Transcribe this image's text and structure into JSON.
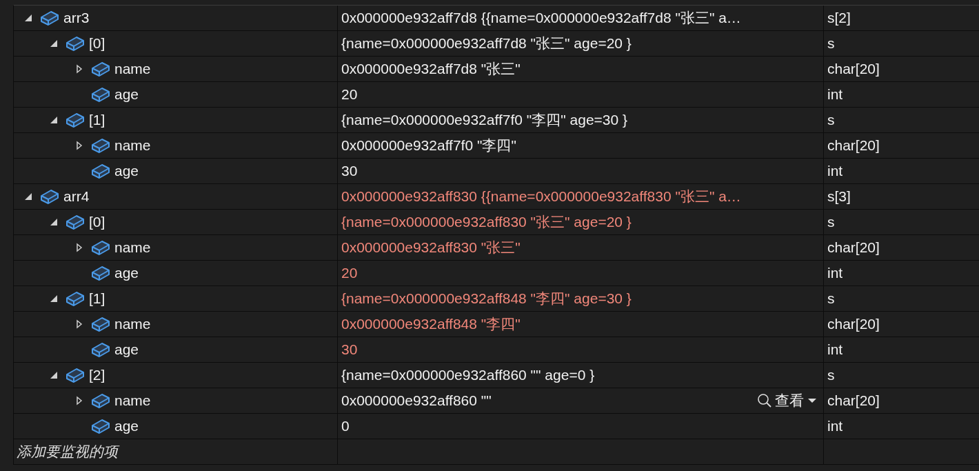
{
  "watch": {
    "items": [
      {
        "name": "arr3",
        "value": "0x000000e932aff7d8 {{name=0x000000e932aff7d8 \"张三\" a…",
        "type": "s[2]",
        "changed": false,
        "expanded": true,
        "children": [
          {
            "name": "[0]",
            "value": "{name=0x000000e932aff7d8 \"张三\" age=20 }",
            "type": "s",
            "changed": false,
            "expanded": true,
            "children": [
              {
                "name": "name",
                "value": "0x000000e932aff7d8 \"张三\"",
                "type": "char[20]",
                "changed": false,
                "expanded": false
              },
              {
                "name": "age",
                "value": "20",
                "type": "int",
                "changed": false
              }
            ]
          },
          {
            "name": "[1]",
            "value": "{name=0x000000e932aff7f0 \"李四\" age=30 }",
            "type": "s",
            "changed": false,
            "expanded": true,
            "children": [
              {
                "name": "name",
                "value": "0x000000e932aff7f0 \"李四\"",
                "type": "char[20]",
                "changed": false,
                "expanded": false
              },
              {
                "name": "age",
                "value": "30",
                "type": "int",
                "changed": false
              }
            ]
          }
        ]
      },
      {
        "name": "arr4",
        "value": "0x000000e932aff830 {{name=0x000000e932aff830 \"张三\" a…",
        "type": "s[3]",
        "changed": true,
        "expanded": true,
        "children": [
          {
            "name": "[0]",
            "value": "{name=0x000000e932aff830 \"张三\" age=20 }",
            "type": "s",
            "changed": true,
            "expanded": true,
            "children": [
              {
                "name": "name",
                "value": "0x000000e932aff830 \"张三\"",
                "type": "char[20]",
                "changed": true,
                "expanded": false
              },
              {
                "name": "age",
                "value": "20",
                "type": "int",
                "changed": true
              }
            ]
          },
          {
            "name": "[1]",
            "value": "{name=0x000000e932aff848 \"李四\" age=30 }",
            "type": "s",
            "changed": true,
            "expanded": true,
            "children": [
              {
                "name": "name",
                "value": "0x000000e932aff848 \"李四\"",
                "type": "char[20]",
                "changed": true,
                "expanded": false
              },
              {
                "name": "age",
                "value": "30",
                "type": "int",
                "changed": true
              }
            ]
          },
          {
            "name": "[2]",
            "value": "{name=0x000000e932aff860 \"\" age=0 }",
            "type": "s",
            "changed": false,
            "expanded": true,
            "children": [
              {
                "name": "name",
                "value": "0x000000e932aff860 \"\"",
                "type": "char[20]",
                "changed": false,
                "expanded": false,
                "visualizer": "查看"
              },
              {
                "name": "age",
                "value": "0",
                "type": "int",
                "changed": false
              }
            ]
          }
        ]
      }
    ],
    "add_item_placeholder": "添加要监视的项"
  }
}
